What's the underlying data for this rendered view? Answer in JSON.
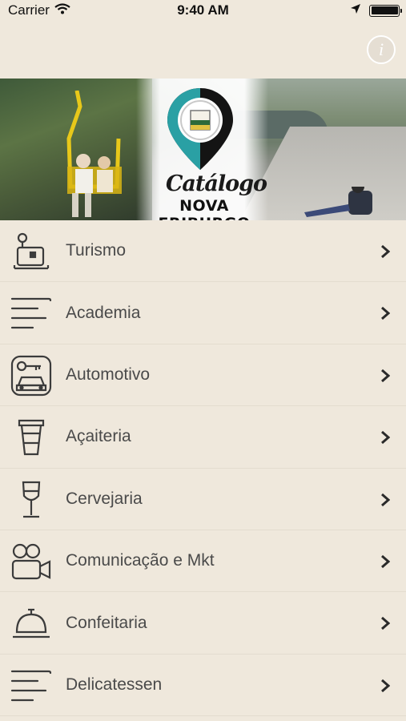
{
  "status_bar": {
    "carrier": "Carrier",
    "time": "9:40 AM"
  },
  "banner": {
    "script_text": "Catálogo",
    "bold_text": "NOVA FRIBURGO"
  },
  "info_button": {
    "label": "i"
  },
  "menu": [
    {
      "label": "Turismo",
      "icon": "luggage-icon"
    },
    {
      "label": "Academia",
      "icon": "lines-icon"
    },
    {
      "label": "Automotivo",
      "icon": "car-key-icon"
    },
    {
      "label": "Açaiteria",
      "icon": "cup-icon"
    },
    {
      "label": "Cervejaria",
      "icon": "wine-glass-icon"
    },
    {
      "label": "Comunicação e Mkt",
      "icon": "video-camera-icon"
    },
    {
      "label": "Confeitaria",
      "icon": "service-bell-icon"
    },
    {
      "label": "Delicatessen",
      "icon": "lines-icon"
    }
  ]
}
